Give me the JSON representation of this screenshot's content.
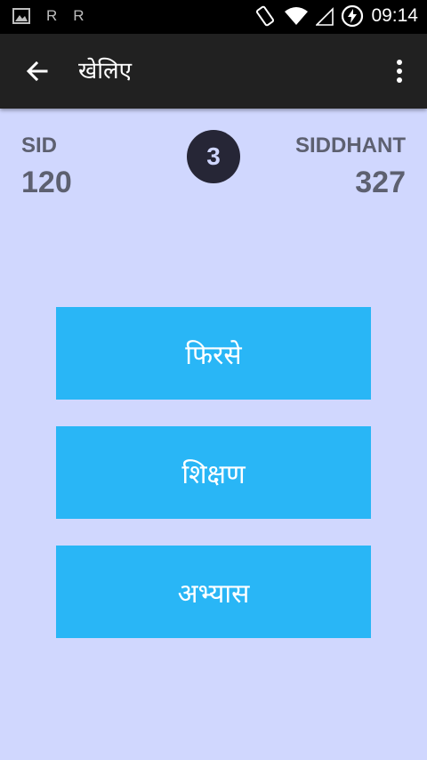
{
  "status_bar": {
    "time": "09:14",
    "left_icons": [
      "image-icon",
      "r-icon",
      "r-icon"
    ],
    "r_glyph": "R",
    "right_icons": [
      "rotate-icon",
      "wifi-icon",
      "signal-icon",
      "battery-charging-icon"
    ]
  },
  "app_bar": {
    "title": "खेलिए",
    "back_icon": "arrow-back-icon",
    "menu_icon": "more-vert-icon",
    "background": "#212121"
  },
  "scoreboard": {
    "player1": {
      "name": "SID",
      "score": "120"
    },
    "round": "3",
    "player2": {
      "name": "SIDDHANT",
      "score": "327"
    }
  },
  "actions": {
    "retry_label": "फिरसे",
    "learn_label": "शिक्षण",
    "practice_label": "अभ्यास",
    "color": "#29b6f6"
  },
  "colors": {
    "background": "#d0d7fe",
    "score_text": "#5d6070",
    "badge": "#262636"
  }
}
